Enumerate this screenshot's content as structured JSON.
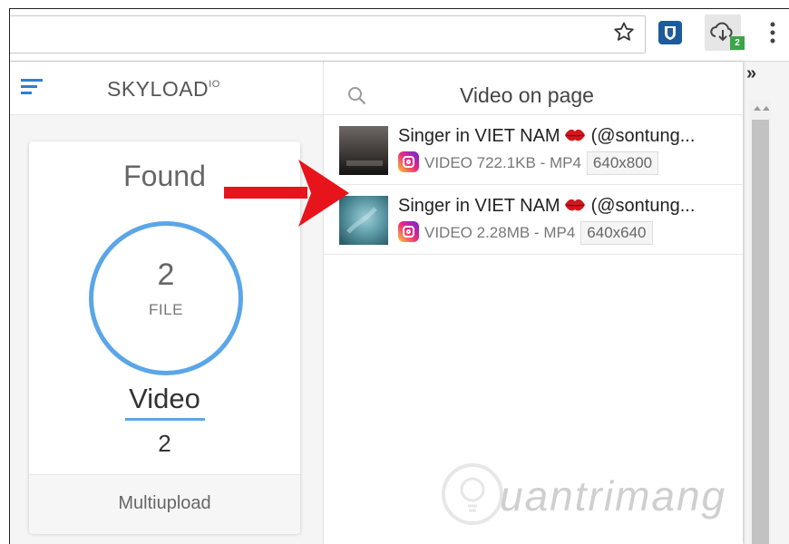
{
  "toolbar": {
    "ext_badge": "2"
  },
  "popup": {
    "brand": "SKYLOAD",
    "brand_sup": "IO",
    "found_label": "Found",
    "file_count": "2",
    "file_label": "FILE",
    "video_label": "Video",
    "video_count": "2",
    "multiupload": "Multiupload",
    "right_title": "Video on page",
    "items": [
      {
        "title_a": "Singer in VIET NAM",
        "title_b": "(@sontung...",
        "meta": "VIDEO 722.1KB - MP4",
        "res": "640x800"
      },
      {
        "title_a": "Singer in VIET NAM",
        "title_b": "(@sontung...",
        "meta": "VIDEO 2.28MB - MP4",
        "res": "640x640"
      }
    ]
  },
  "watermark": "uantrimang",
  "colors": {
    "accent": "#5aa6e8",
    "badge": "#3aa54a",
    "arrow": "#e8141c"
  }
}
